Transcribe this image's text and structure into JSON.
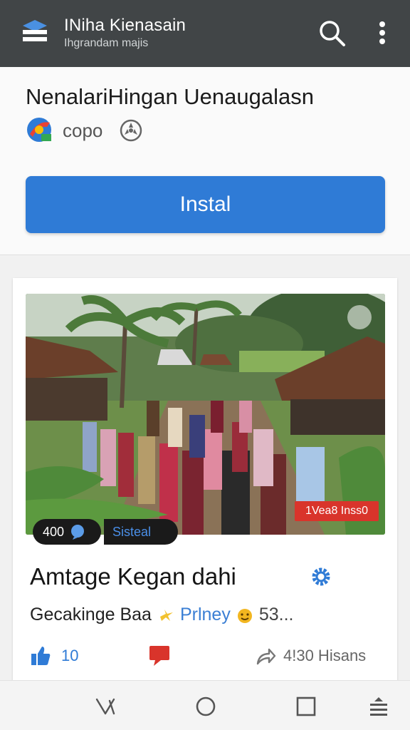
{
  "appbar": {
    "title": "INiha Kienasain",
    "subtitle": "Ihgrandam majis",
    "logo_icon": "stacked-layers-icon",
    "search_icon": "search-icon",
    "more_icon": "more-vert-icon",
    "background": "#414547"
  },
  "install_panel": {
    "title": "NenalariHingan Uenaugalasn",
    "developer": "copo",
    "developer_icon": "app-badge-icon",
    "verified_icon": "verified-icon",
    "install_label": "Instal",
    "accent": "#2f7bd6"
  },
  "card": {
    "image_icon": "village-gathering-photo",
    "count_chip": "400",
    "tag_chip": "Sisteal",
    "badge": "1Vea8 Inss0",
    "title": "Amtage Kegan dahi",
    "meta_author": "Gecakinge Baa",
    "meta_link": "Prlney",
    "meta_count": "53...",
    "likes": "10",
    "shares": "4!30 Hisans",
    "badge_color": "#d9342b"
  },
  "navbar": {
    "back_icon": "back-icon",
    "home_icon": "home-circle-icon",
    "recents_icon": "recents-square-icon",
    "menu_icon": "menu-icon"
  }
}
